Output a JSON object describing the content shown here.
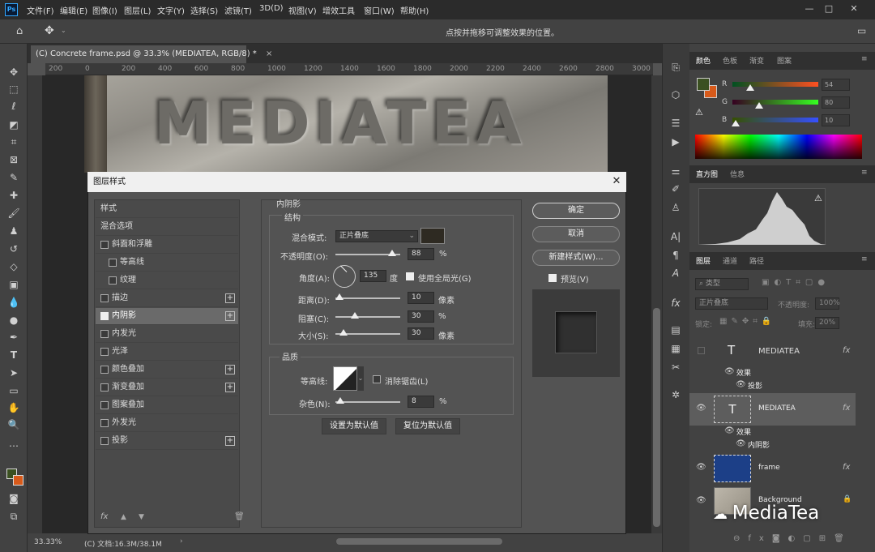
{
  "app": {
    "logo": "Ps"
  },
  "menu": [
    "文件(F)",
    "编辑(E)",
    "图像(I)",
    "图层(L)",
    "文字(Y)",
    "选择(S)",
    "滤镜(T)",
    "3D(D)",
    "视图(V)",
    "增效工具",
    "窗口(W)",
    "帮助(H)"
  ],
  "window_controls": {
    "minimize": "—",
    "maximize": "□",
    "close": "✕"
  },
  "options_bar": {
    "hint": "点按并拖移可调整效果的位置。"
  },
  "document": {
    "tab_title": "(C) Concrete frame.psd @ 33.3% (MEDIATEA, RGB/8) *",
    "tab_close": "×",
    "ruler_ticks": [
      "200",
      "0",
      "200",
      "400",
      "600",
      "800",
      "1000",
      "1200",
      "1400",
      "1600",
      "1800",
      "2000",
      "2200",
      "2400",
      "2600",
      "2800",
      "3000"
    ],
    "artwork_text": "MEDIATEA"
  },
  "status": {
    "zoom": "33.33%",
    "doc_info": "(C) 文档:16.3M/38.1M",
    "arrow": "›"
  },
  "color_panel": {
    "tabs": [
      "颜色",
      "色板",
      "渐变",
      "图案"
    ],
    "fg_color": "#3b5021",
    "bg_color": "#d85a1a",
    "channels": [
      {
        "label": "R",
        "value": "54",
        "level": 0.21,
        "grad": "linear-gradient(90deg,#005021,#ff5021)"
      },
      {
        "label": "G",
        "value": "80",
        "level": 0.31,
        "grad": "linear-gradient(90deg,#360021,#36ff21)"
      },
      {
        "label": "B",
        "value": "10",
        "level": 0.04,
        "grad": "linear-gradient(90deg,#365000,#3650ff)"
      }
    ]
  },
  "histogram_panel": {
    "tabs": [
      "直方图",
      "信息"
    ],
    "warning": "⚠"
  },
  "layers_panel": {
    "tabs": [
      "图层",
      "通道",
      "路径"
    ],
    "kind_filter": "类型",
    "blend_mode": "正片叠底",
    "opacity_label": "不透明度:",
    "opacity_value": "100%",
    "lock_label": "锁定:",
    "fill_label": "填充:",
    "fill_value": "20%",
    "layers": [
      {
        "name": "MEDIATEA",
        "thumb": "T",
        "fx": "fx",
        "effects_label": "效果",
        "effects": [
          "投影"
        ]
      },
      {
        "name": "MEDIATEA",
        "thumb": "T",
        "fx": "fx",
        "effects_label": "效果",
        "effects": [
          "内阴影"
        ]
      },
      {
        "name": "frame",
        "fx": "fx"
      },
      {
        "name": "Background",
        "lock": "🔒"
      }
    ]
  },
  "watermark": "MediaTea",
  "dialog": {
    "title": "图层样式",
    "close": "✕",
    "styles": [
      {
        "label": "样式",
        "checkbox": false,
        "plus": false,
        "checked": false
      },
      {
        "label": "混合选项",
        "checkbox": false,
        "plus": false,
        "checked": false
      },
      {
        "label": "斜面和浮雕",
        "checkbox": true,
        "plus": false,
        "checked": false
      },
      {
        "label": "等高线",
        "checkbox": true,
        "plus": false,
        "checked": false
      },
      {
        "label": "纹理",
        "checkbox": true,
        "plus": false,
        "checked": false
      },
      {
        "label": "描边",
        "checkbox": true,
        "plus": true,
        "checked": false
      },
      {
        "label": "内阴影",
        "checkbox": true,
        "plus": true,
        "checked": true
      },
      {
        "label": "内发光",
        "checkbox": true,
        "plus": false,
        "checked": false
      },
      {
        "label": "光泽",
        "checkbox": true,
        "plus": false,
        "checked": false
      },
      {
        "label": "颜色叠加",
        "checkbox": true,
        "plus": true,
        "checked": false
      },
      {
        "label": "渐变叠加",
        "checkbox": true,
        "plus": true,
        "checked": false
      },
      {
        "label": "图案叠加",
        "checkbox": true,
        "plus": false,
        "checked": false
      },
      {
        "label": "外发光",
        "checkbox": true,
        "plus": false,
        "checked": false
      },
      {
        "label": "投影",
        "checkbox": true,
        "plus": true,
        "checked": false
      }
    ],
    "bottom_icons": {
      "fx": "fx",
      "up": "▲",
      "down": "▼",
      "trash": "🗑"
    },
    "section_title": "内阴影",
    "structure": {
      "title": "结构",
      "blend_label": "混合模式:",
      "blend_value": "正片叠底",
      "swatch_color": "#2e2a22",
      "opacity_label": "不透明度(O):",
      "opacity_value": "88",
      "opacity_level": 0.88,
      "percent": "%",
      "angle_label": "角度(A):",
      "angle_value": "135",
      "angle_unit": "度",
      "global_light": "使用全局光(G)",
      "distance_label": "距离(D):",
      "distance_value": "10",
      "distance_level": 0.06,
      "px": "像素",
      "choke_label": "阻塞(C):",
      "choke_value": "30",
      "choke_level": 0.3,
      "size_label": "大小(S):",
      "size_value": "30",
      "size_level": 0.12
    },
    "quality": {
      "title": "品质",
      "contour_label": "等高线:",
      "antialias": "消除锯齿(L)",
      "noise_label": "杂色(N):",
      "noise_value": "8",
      "noise_level": 0.08
    },
    "make_default": "设置为默认值",
    "reset_default": "复位为默认值",
    "ok": "确定",
    "cancel": "取消",
    "new_style": "新建样式(W)...",
    "preview": "预览(V)"
  }
}
